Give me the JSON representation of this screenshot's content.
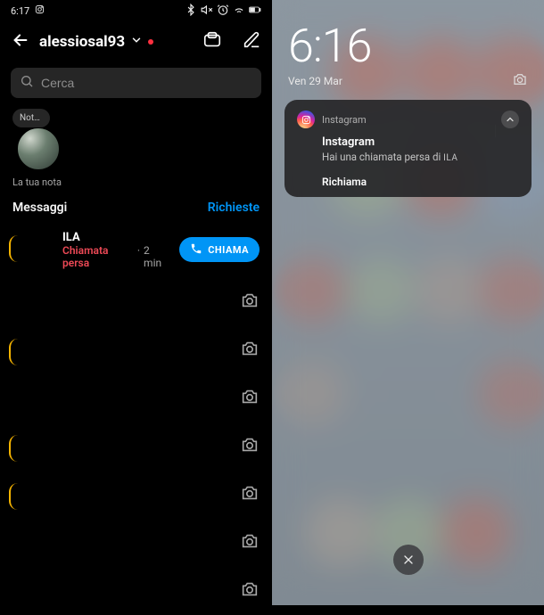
{
  "left": {
    "status": {
      "time": "6:17"
    },
    "header": {
      "username": "alessiosal93"
    },
    "search": {
      "placeholder": "Cerca"
    },
    "note": {
      "bubble": "Nota…",
      "label": "La tua nota"
    },
    "tabs": {
      "messages": "Messaggi",
      "requests": "Richieste"
    },
    "conversation": {
      "name": "ILA",
      "missed_label": "Chiamata persa",
      "separator": "·",
      "time": "2 min",
      "call_button": "CHIAMA"
    }
  },
  "right": {
    "clock": "6:16",
    "date": "Ven 29 Mar",
    "notification": {
      "app": "Instagram",
      "title": "Instagram",
      "body_prefix": "Hai una chiamata persa di ",
      "body_sender": "ILA",
      "action": "Richiama"
    }
  }
}
